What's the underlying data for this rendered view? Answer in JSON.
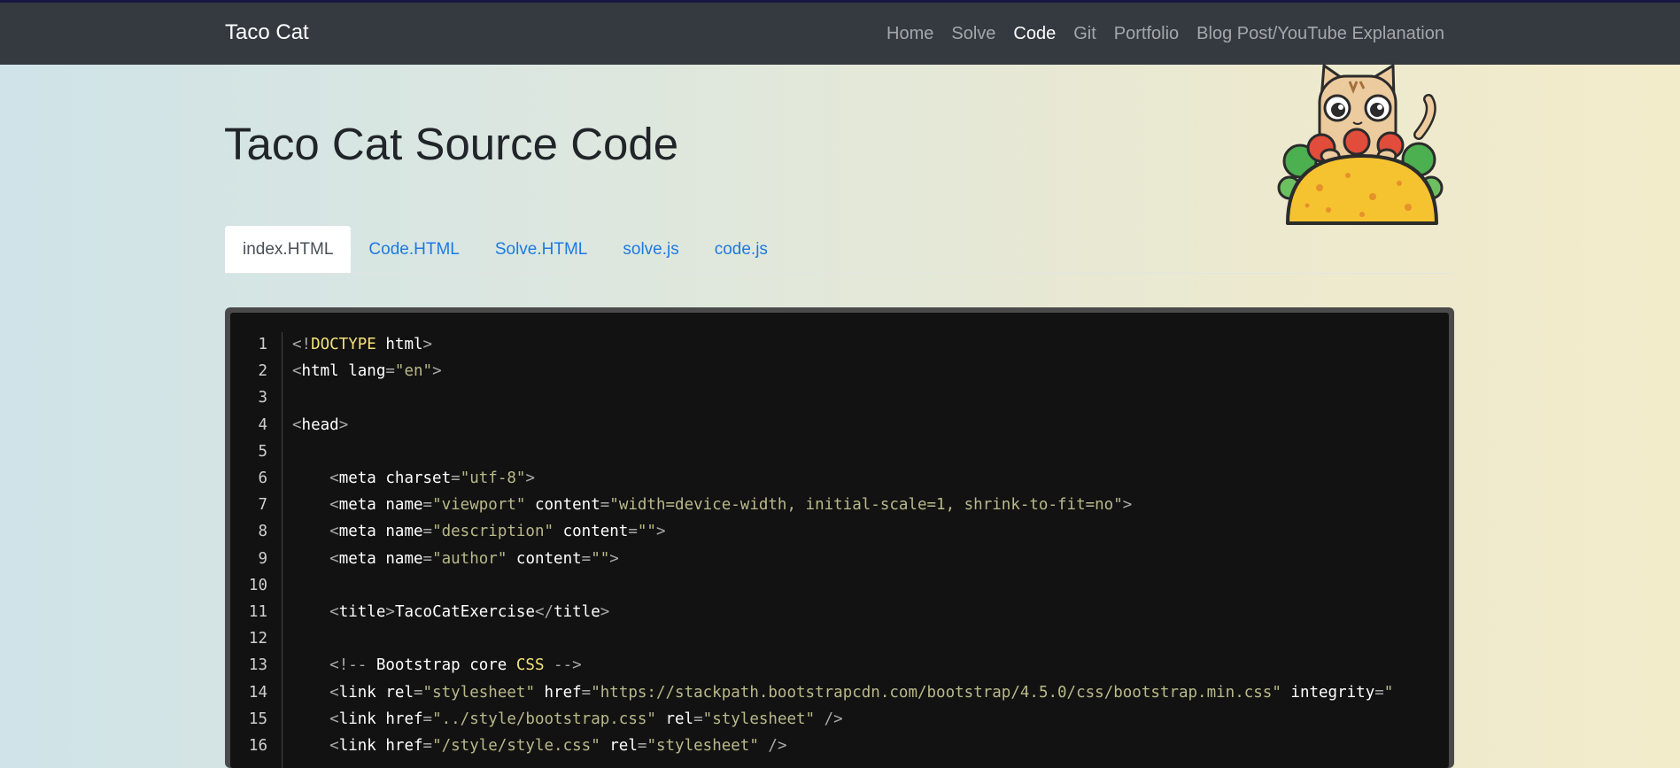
{
  "navbar": {
    "brand": "Taco Cat",
    "links": [
      "Home",
      "Solve",
      "Code",
      "Git",
      "Portfolio",
      "Blog Post/YouTube Explanation"
    ],
    "active": "Code"
  },
  "page": {
    "title": "Taco Cat Source Code"
  },
  "tabs": [
    "index.HTML",
    "Code.HTML",
    "Solve.HTML",
    "solve.js",
    "code.js"
  ],
  "code": {
    "line_numbers": [
      "1",
      "2",
      "3",
      "4",
      "5",
      "6",
      "7",
      "8",
      "9",
      "10",
      "11",
      "12",
      "13",
      "14",
      "15",
      "16"
    ],
    "lines": [
      [
        [
          "p",
          "<!"
        ],
        [
          "k",
          "DOCTYPE"
        ],
        [
          "t",
          " html"
        ],
        [
          "p",
          ">"
        ]
      ],
      [
        [
          "p",
          "<"
        ],
        [
          "t",
          "html lang"
        ],
        [
          "p",
          "="
        ],
        [
          "s",
          "\"en\""
        ],
        [
          "p",
          ">"
        ]
      ],
      [],
      [
        [
          "p",
          "<"
        ],
        [
          "t",
          "head"
        ],
        [
          "p",
          ">"
        ]
      ],
      [],
      [
        [
          "t",
          "    "
        ],
        [
          "p",
          "<"
        ],
        [
          "t",
          "meta charset"
        ],
        [
          "p",
          "="
        ],
        [
          "s",
          "\"utf-8\""
        ],
        [
          "p",
          ">"
        ]
      ],
      [
        [
          "t",
          "    "
        ],
        [
          "p",
          "<"
        ],
        [
          "t",
          "meta name"
        ],
        [
          "p",
          "="
        ],
        [
          "s",
          "\"viewport\""
        ],
        [
          "t",
          " content"
        ],
        [
          "p",
          "="
        ],
        [
          "s",
          "\"width=device-width, initial-scale=1, shrink-to-fit=no\""
        ],
        [
          "p",
          ">"
        ]
      ],
      [
        [
          "t",
          "    "
        ],
        [
          "p",
          "<"
        ],
        [
          "t",
          "meta name"
        ],
        [
          "p",
          "="
        ],
        [
          "s",
          "\"description\""
        ],
        [
          "t",
          " content"
        ],
        [
          "p",
          "="
        ],
        [
          "s",
          "\"\""
        ],
        [
          "p",
          ">"
        ]
      ],
      [
        [
          "t",
          "    "
        ],
        [
          "p",
          "<"
        ],
        [
          "t",
          "meta name"
        ],
        [
          "p",
          "="
        ],
        [
          "s",
          "\"author\""
        ],
        [
          "t",
          " content"
        ],
        [
          "p",
          "="
        ],
        [
          "s",
          "\"\""
        ],
        [
          "p",
          ">"
        ]
      ],
      [],
      [
        [
          "t",
          "    "
        ],
        [
          "p",
          "<"
        ],
        [
          "t",
          "title"
        ],
        [
          "p",
          ">"
        ],
        [
          "t",
          "TacoCatExercise"
        ],
        [
          "p",
          "</"
        ],
        [
          "t",
          "title"
        ],
        [
          "p",
          ">"
        ]
      ],
      [],
      [
        [
          "t",
          "    "
        ],
        [
          "p",
          "<!-- "
        ],
        [
          "t",
          "Bootstrap core "
        ],
        [
          "k",
          "CSS"
        ],
        [
          "p",
          " -->"
        ]
      ],
      [
        [
          "t",
          "    "
        ],
        [
          "p",
          "<"
        ],
        [
          "t",
          "link rel"
        ],
        [
          "p",
          "="
        ],
        [
          "s",
          "\"stylesheet\""
        ],
        [
          "t",
          " href"
        ],
        [
          "p",
          "="
        ],
        [
          "s",
          "\"https://stackpath.bootstrapcdn.com/bootstrap/4.5.0/css/bootstrap.min.css\""
        ],
        [
          "t",
          " integrity"
        ],
        [
          "p",
          "="
        ],
        [
          "s",
          "\""
        ]
      ],
      [
        [
          "t",
          "    "
        ],
        [
          "p",
          "<"
        ],
        [
          "t",
          "link href"
        ],
        [
          "p",
          "="
        ],
        [
          "s",
          "\"../style/bootstrap.css\""
        ],
        [
          "t",
          " rel"
        ],
        [
          "p",
          "="
        ],
        [
          "s",
          "\"stylesheet\""
        ],
        [
          "p",
          " />"
        ]
      ],
      [
        [
          "t",
          "    "
        ],
        [
          "p",
          "<"
        ],
        [
          "t",
          "link href"
        ],
        [
          "p",
          "="
        ],
        [
          "s",
          "\"/style/style.css\""
        ],
        [
          "t",
          " rel"
        ],
        [
          "p",
          "="
        ],
        [
          "s",
          "\"stylesheet\""
        ],
        [
          "p",
          " />"
        ]
      ]
    ]
  },
  "colors": {
    "navbar_bg": "#343a40",
    "tab_link": "#1f7ae0",
    "code_bg": "#121212",
    "taco_shell": "#f5c330",
    "cat_fur": "#eccb9e"
  },
  "icons": {
    "illustration": "taco-cat-icon"
  }
}
